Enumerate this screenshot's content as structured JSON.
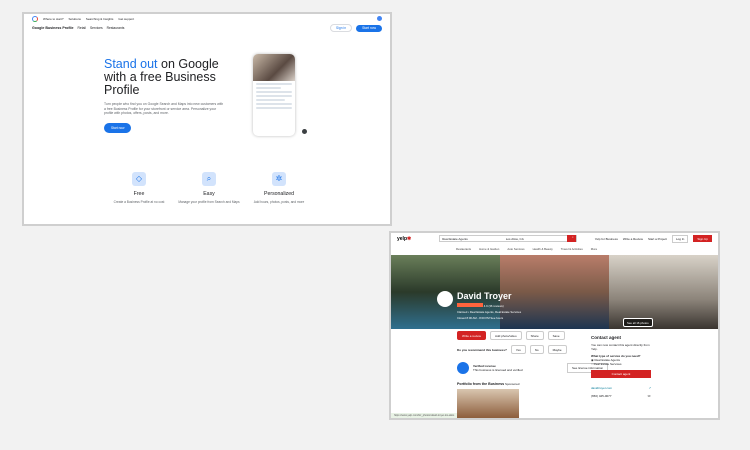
{
  "google": {
    "top_links": [
      "Where to start?",
      "Solutions",
      "Searching & Insights",
      "Get support"
    ],
    "brand": "Google Business Profile",
    "nav": [
      "Retail",
      "Services",
      "Restaurants"
    ],
    "sign_in": "Sign in",
    "start_now": "Start now",
    "headline_accent": "Stand out",
    "headline_rest": " on Google with a free Business Profile",
    "description": "Turn people who find you on Google Search and Maps into new customers with a free Business Profile for your storefront or service area. Personalize your profile with photos, offers, posts, and more.",
    "cta": "Start now",
    "features": [
      {
        "title": "Free",
        "desc": "Create a Business Profile at no cost",
        "icon": "tag-icon"
      },
      {
        "title": "Easy",
        "desc": "Manage your profile from Search and Maps",
        "icon": "search-edit-icon"
      },
      {
        "title": "Personalized",
        "desc": "Add hours, photos, posts, and more",
        "icon": "settings-icon"
      }
    ]
  },
  "yelp": {
    "logo": "yelp",
    "search_what": "Real Estate Agents",
    "search_where": "Los Altos, CA",
    "nav": [
      "Yelp for Business",
      "Write a Review",
      "Start a Project"
    ],
    "log_in": "Log In",
    "sign_up": "Sign Up",
    "categories": [
      "Restaurants",
      "Home & Garden",
      "Auto Services",
      "Health & Beauty",
      "Travel & Activities",
      "More"
    ],
    "business_name": "David Troyer",
    "reviews": "4.9 (36 reviews)",
    "claimed": "Claimed • Real Estate Agents, Real Estate Services",
    "hours": "Closed 8:00 AM - 8:00 PM  See hours",
    "see_all": "See all 16 photos",
    "actions": [
      "Write a review",
      "Add photo/video",
      "Share",
      "Save"
    ],
    "recommend_q": "Do you recommend this business?",
    "recommend_opts": [
      "Yes",
      "No",
      "Maybe"
    ],
    "verified_title": "Verified License",
    "verified_desc": "This business is licensed and verified",
    "license_btn": "See license information",
    "portfolio": "Portfolio from the Business",
    "sponsored": "Sponsored",
    "contact": {
      "title": "Contact agent",
      "desc": "You can now contact this agent directly from Yelp.",
      "q": "What type of service do you need?",
      "opts": [
        "Real Estate Agents",
        "Real Estate Services"
      ],
      "btn": "Contact agent",
      "website": "davidtroyer.com",
      "phone": "(650) 425-0077"
    },
    "status_url": "https://www.yelp.com/biz_photos/david-troyer-los-altos"
  }
}
